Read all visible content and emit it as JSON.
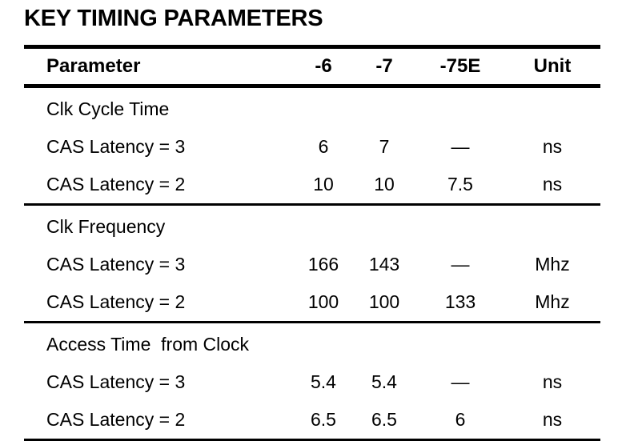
{
  "document": {
    "title": "KEY TIMING PARAMETERS"
  },
  "table": {
    "columns": [
      {
        "key": "parameter",
        "label": "Parameter"
      },
      {
        "key": "m6",
        "label": "-6"
      },
      {
        "key": "m7",
        "label": "-7"
      },
      {
        "key": "m75e",
        "label": "-75E"
      },
      {
        "key": "unit",
        "label": "Unit"
      }
    ],
    "groups": [
      {
        "name": "Clk Cycle Time",
        "rows": [
          {
            "parameter": "CAS Latency = 3",
            "m6": "6",
            "m7": "7",
            "m75e": "—",
            "unit": "ns"
          },
          {
            "parameter": "CAS Latency = 2",
            "m6": "10",
            "m7": "10",
            "m75e": "7.5",
            "unit": "ns"
          }
        ]
      },
      {
        "name": "Clk Frequency",
        "rows": [
          {
            "parameter": "CAS Latency = 3",
            "m6": "166",
            "m7": "143",
            "m75e": "—",
            "unit": "Mhz"
          },
          {
            "parameter": "CAS Latency = 2",
            "m6": "100",
            "m7": "100",
            "m75e": "133",
            "unit": "Mhz"
          }
        ]
      },
      {
        "name": "Access Time  from Clock",
        "rows": [
          {
            "parameter": "CAS Latency = 3",
            "m6": "5.4",
            "m7": "5.4",
            "m75e": "—",
            "unit": "ns"
          },
          {
            "parameter": "CAS Latency = 2",
            "m6": "6.5",
            "m7": "6.5",
            "m75e": "6",
            "unit": "ns"
          }
        ]
      }
    ]
  },
  "colors": {
    "text": "#000000",
    "background": "#ffffff",
    "rule": "#000000"
  }
}
